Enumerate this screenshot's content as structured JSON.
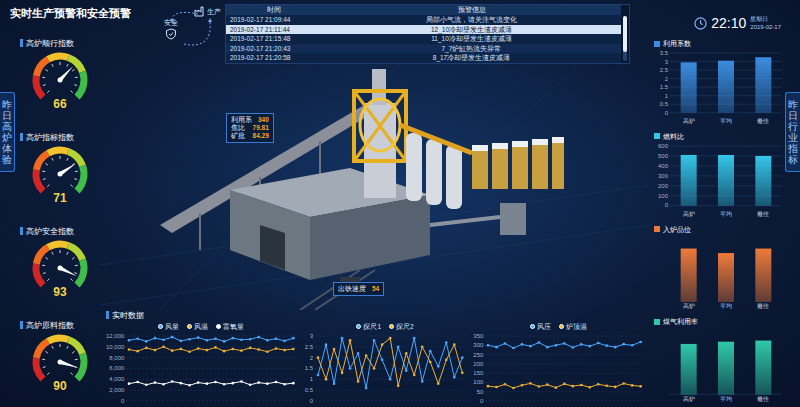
{
  "title": "实时生产预警和安全预警",
  "flow": {
    "nodes": [
      {
        "label": "安全"
      },
      {
        "label": "生产"
      }
    ]
  },
  "alarm_table": {
    "columns": [
      "时间",
      "预警信息"
    ],
    "rows": [
      {
        "cells": [
          "2019-02-17 21:09:44",
          "局部小气流，请关注气流变化"
        ],
        "selected": false
      },
      {
        "cells": [
          "2019-02-17 21:11:44",
          "12_10冷却壁发生渣皮减薄"
        ],
        "selected": true
      },
      {
        "cells": [
          "2019-02-17 21:15:48",
          "11_10冷却壁发生渣皮减薄"
        ],
        "selected": false
      },
      {
        "cells": [
          "2019-02-17 21:20:43",
          "7_7炉缸热流失异常"
        ],
        "selected": false
      },
      {
        "cells": [
          "2019-02-17 21:20:58",
          "8_17冷却壁发生渣皮减薄"
        ],
        "selected": false
      }
    ],
    "scrollbar": {
      "level": 0.8
    }
  },
  "clock": {
    "time": "22:10",
    "weekday": "星期日",
    "date": "2019-02-17"
  },
  "left_panel": {
    "tab": "昨日高炉体验",
    "gauges": [
      {
        "title": "高炉顺行指数",
        "value": "66",
        "level": 0.66
      },
      {
        "title": "高炉指标指数",
        "value": "71",
        "level": 0.71
      },
      {
        "title": "高炉安全指数",
        "value": "93",
        "level": 0.93
      },
      {
        "title": "高炉原料指数",
        "value": "90",
        "level": 0.9
      }
    ]
  },
  "right_panel": {
    "tab": "昨日行业指标",
    "charts": [
      {
        "title": "利用系数",
        "color": "#3b8de0",
        "ticks": [
          "3.5",
          "3",
          "2.5",
          "2",
          "1.5",
          "1",
          "0.5",
          "0"
        ],
        "bars": [
          {
            "label": "高炉",
            "value": 2.95
          },
          {
            "label": "平均",
            "value": 3.05
          },
          {
            "label": "最佳",
            "value": 3.25
          }
        ]
      },
      {
        "title": "燃料比",
        "color": "#34c6e8",
        "ticks": [
          "600",
          "500",
          "400",
          "300",
          "200",
          "100",
          "0"
        ],
        "bars": [
          {
            "label": "高炉",
            "value": 510
          },
          {
            "label": "平均",
            "value": 510
          },
          {
            "label": "最佳",
            "value": 500
          }
        ]
      },
      {
        "title": "入炉品位",
        "color": "#f07a3a",
        "ticks": [],
        "bars": [
          {
            "label": "高炉",
            "value": 60
          },
          {
            "label": "平均",
            "value": 55
          },
          {
            "label": "最佳",
            "value": 60
          }
        ]
      },
      {
        "title": "煤气利用率",
        "color": "#2fc9a8",
        "ticks": [],
        "bars": [
          {
            "label": "高炉",
            "value": 45
          },
          {
            "label": "平均",
            "value": 47
          },
          {
            "label": "最佳",
            "value": 48
          }
        ]
      }
    ]
  },
  "scene": {
    "callouts": [
      {
        "rows": [
          {
            "label": "利用系",
            "value": "340"
          },
          {
            "label": "焦比",
            "value": "79.81"
          },
          {
            "label": "矿批",
            "value": "84.29"
          }
        ]
      },
      {
        "rows": [
          {
            "label": "出铁速度",
            "value": "54"
          }
        ]
      }
    ]
  },
  "realtime": {
    "title": "实时数据",
    "charts": [
      {
        "ticks": [
          "12,000",
          "10,000",
          "8,000",
          "6,000",
          "4,000",
          "2,000",
          "0"
        ],
        "series": [
          {
            "name": "风量",
            "color": "#4aa8ff",
            "values": [
              11200,
              11500,
              11000,
              11600,
              11300,
              11800,
              11100,
              11400,
              11700,
              11200,
              11500,
              11000,
              11600,
              11300,
              11400,
              11800,
              11200,
              11500,
              11100,
              11600
            ]
          },
          {
            "name": "风温",
            "color": "#f0b030",
            "values": [
              9500,
              9200,
              9800,
              9400,
              10000,
              9300,
              9600,
              9100,
              9700,
              9400,
              9900,
              9200,
              9600,
              9300,
              9800,
              9500,
              9100,
              9700,
              9400,
              9600
            ]
          },
          {
            "name": "富氧量",
            "color": "#ffffff",
            "values": [
              3200,
              3500,
              3000,
              3400,
              3100,
              3600,
              3300,
              2900,
              3400,
              3200,
              3500,
              3100,
              3300,
              3600,
              3000,
              3400,
              3200,
              3500,
              3100,
              3300
            ]
          }
        ]
      },
      {
        "ticks": [
          "3",
          "2.5",
          "2",
          "1.5",
          "1",
          "0.5",
          "0"
        ],
        "series": [
          {
            "name": "探尺1",
            "color": "#4aa8ff",
            "values": [
              1.2,
              2.6,
              0.8,
              2.9,
              1.5,
              2.2,
              0.6,
              2.8,
              1.9,
              1.0,
              2.5,
              1.4,
              2.9,
              0.9,
              2.3,
              1.6,
              2.7,
              1.1,
              2.0
            ]
          },
          {
            "name": "探尺2",
            "color": "#f0b030",
            "values": [
              2.0,
              1.0,
              2.4,
              1.3,
              2.8,
              0.9,
              2.1,
              1.5,
              2.6,
              2.9,
              0.7,
              2.2,
              1.2,
              2.5,
              1.8,
              0.8,
              1.9,
              2.6,
              1.3
            ]
          }
        ]
      },
      {
        "ticks": [
          "350",
          "300",
          "250",
          "200",
          "150",
          "100",
          "50",
          "0"
        ],
        "series": [
          {
            "name": "风压",
            "color": "#4aa8ff",
            "values": [
              300,
              290,
              310,
              285,
              305,
              295,
              315,
              290,
              300,
              310,
              288,
              305,
              295,
              312,
              298,
              290,
              306,
              300,
              318
            ]
          },
          {
            "name": "炉顶温",
            "color": "#f0b030",
            "values": [
              80,
              75,
              90,
              70,
              85,
              95,
              78,
              88,
              72,
              92,
              80,
              86,
              74,
              90,
              82,
              76,
              94,
              84,
              79
            ]
          }
        ]
      }
    ]
  }
}
